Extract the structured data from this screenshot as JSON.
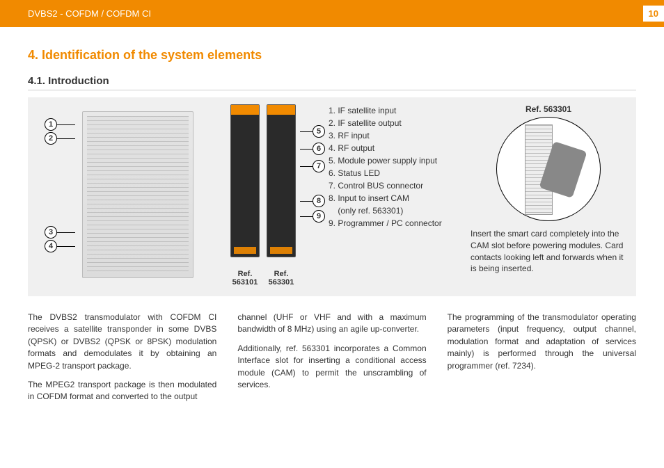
{
  "header": {
    "title": "DVBS2 - COFDM / COFDM CI",
    "page": "10"
  },
  "section": {
    "h4": "4. Identification of the system elements",
    "h41": "4.1. Introduction"
  },
  "figure": {
    "left_callouts": [
      "1",
      "2",
      "3",
      "4"
    ],
    "mid_callouts": [
      "5",
      "6",
      "7",
      "8",
      "9"
    ],
    "refs": {
      "a": "Ref. 563101",
      "b": "Ref. 563301"
    },
    "legend": [
      "1. IF satellite input",
      "2. IF satellite output",
      "3. RF input",
      "4. RF output",
      "5. Module power supply input",
      "6. Status LED",
      "7. Control BUS connector",
      "8. Input to insert CAM",
      "    (only ref. 563301)",
      "9. Programmer / PC connector"
    ],
    "detail_ref": "Ref. 563301",
    "caption": "Insert the smart card completely into the CAM slot before powering modules. Card contacts looking left and forwards when it is being inserted."
  },
  "body": {
    "c1p1": "The DVBS2 transmodulator with COFDM CI receives a satellite transponder in some DVBS (QPSK) or DVBS2 (QPSK or 8PSK) modulation formats and demodulates it by obtaining an MPEG-2 transport package.",
    "c1p2": "The MPEG2 transport package is then modulated in COFDM format and converted to the output",
    "c2p1": "channel (UHF or VHF and with a maximum bandwidth of 8 MHz) using an agile up-converter.",
    "c2p2": "Additionally, ref. 563301 incorporates a Common Interface slot for inserting a conditional access module (CAM) to permit the unscrambling of services.",
    "c3p1": "The programming of the transmodulator operating parameters (input frequency, output channel, modulation format and adaptation of services mainly) is performed through the universal programmer (ref. 7234)."
  }
}
